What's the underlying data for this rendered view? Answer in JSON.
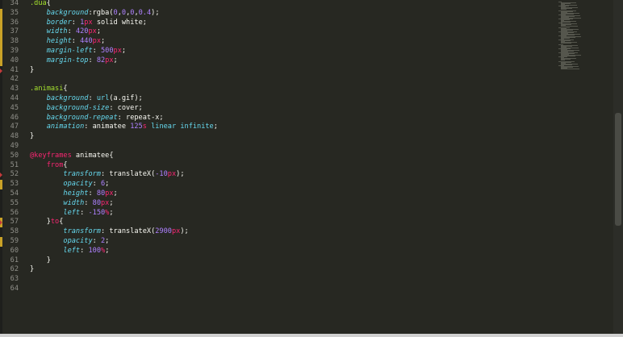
{
  "editor": {
    "lines": [
      {
        "n": "34",
        "tokens": [
          {
            "t": ".dua",
            "c": "sel"
          },
          {
            "t": "{",
            "c": "plain"
          }
        ]
      },
      {
        "n": "35",
        "tokens": [
          {
            "t": "    ",
            "c": "plain"
          },
          {
            "t": "background",
            "c": "prop"
          },
          {
            "t": ":rgba(",
            "c": "plain"
          },
          {
            "t": "0",
            "c": "num"
          },
          {
            "t": ",",
            "c": "plain"
          },
          {
            "t": "0",
            "c": "num"
          },
          {
            "t": ",",
            "c": "plain"
          },
          {
            "t": "0",
            "c": "num"
          },
          {
            "t": ",",
            "c": "plain"
          },
          {
            "t": "0.4",
            "c": "num"
          },
          {
            "t": ");",
            "c": "plain"
          }
        ]
      },
      {
        "n": "36",
        "tokens": [
          {
            "t": "    ",
            "c": "plain"
          },
          {
            "t": "border",
            "c": "prop"
          },
          {
            "t": ": ",
            "c": "plain"
          },
          {
            "t": "1",
            "c": "num"
          },
          {
            "t": "px",
            "c": "unit"
          },
          {
            "t": " solid white;",
            "c": "plain"
          }
        ]
      },
      {
        "n": "37",
        "tokens": [
          {
            "t": "    ",
            "c": "plain"
          },
          {
            "t": "width",
            "c": "prop"
          },
          {
            "t": ": ",
            "c": "plain"
          },
          {
            "t": "420",
            "c": "num"
          },
          {
            "t": "px",
            "c": "unit"
          },
          {
            "t": ";",
            "c": "plain"
          }
        ]
      },
      {
        "n": "38",
        "tokens": [
          {
            "t": "    ",
            "c": "plain"
          },
          {
            "t": "height",
            "c": "prop"
          },
          {
            "t": ": ",
            "c": "plain"
          },
          {
            "t": "440",
            "c": "num"
          },
          {
            "t": "px",
            "c": "unit"
          },
          {
            "t": ";",
            "c": "plain"
          }
        ]
      },
      {
        "n": "39",
        "tokens": [
          {
            "t": "    ",
            "c": "plain"
          },
          {
            "t": "margin-left",
            "c": "prop"
          },
          {
            "t": ": ",
            "c": "plain"
          },
          {
            "t": "500",
            "c": "num"
          },
          {
            "t": "px",
            "c": "unit"
          },
          {
            "t": ";",
            "c": "plain"
          }
        ]
      },
      {
        "n": "40",
        "tokens": [
          {
            "t": "    ",
            "c": "plain"
          },
          {
            "t": "margin-top",
            "c": "prop"
          },
          {
            "t": ": ",
            "c": "plain"
          },
          {
            "t": "82",
            "c": "num"
          },
          {
            "t": "px",
            "c": "unit"
          },
          {
            "t": ";",
            "c": "plain"
          }
        ]
      },
      {
        "n": "41",
        "tokens": [
          {
            "t": "}",
            "c": "plain"
          }
        ]
      },
      {
        "n": "42",
        "tokens": []
      },
      {
        "n": "43",
        "tokens": [
          {
            "t": ".animasi",
            "c": "sel"
          },
          {
            "t": "{",
            "c": "plain"
          }
        ]
      },
      {
        "n": "44",
        "tokens": [
          {
            "t": "    ",
            "c": "plain"
          },
          {
            "t": "background",
            "c": "prop"
          },
          {
            "t": ": ",
            "c": "plain"
          },
          {
            "t": "url",
            "c": "func"
          },
          {
            "t": "(a.gif);",
            "c": "plain"
          }
        ]
      },
      {
        "n": "45",
        "tokens": [
          {
            "t": "    ",
            "c": "plain"
          },
          {
            "t": "background-size",
            "c": "prop"
          },
          {
            "t": ": cover;",
            "c": "plain"
          }
        ]
      },
      {
        "n": "46",
        "tokens": [
          {
            "t": "    ",
            "c": "plain"
          },
          {
            "t": "background-repeat",
            "c": "prop"
          },
          {
            "t": ": repeat-x;",
            "c": "plain"
          }
        ]
      },
      {
        "n": "47",
        "tokens": [
          {
            "t": "    ",
            "c": "plain"
          },
          {
            "t": "animation",
            "c": "prop"
          },
          {
            "t": ": animatee ",
            "c": "plain"
          },
          {
            "t": "125",
            "c": "num"
          },
          {
            "t": "s",
            "c": "unit"
          },
          {
            "t": " ",
            "c": "plain"
          },
          {
            "t": "linear",
            "c": "func"
          },
          {
            "t": " ",
            "c": "plain"
          },
          {
            "t": "infinite",
            "c": "func"
          },
          {
            "t": ";",
            "c": "plain"
          }
        ]
      },
      {
        "n": "48",
        "tokens": [
          {
            "t": "}",
            "c": "plain"
          }
        ]
      },
      {
        "n": "49",
        "tokens": []
      },
      {
        "n": "50",
        "tokens": [
          {
            "t": "@keyframes",
            "c": "kw"
          },
          {
            "t": " animatee{",
            "c": "plain"
          }
        ]
      },
      {
        "n": "51",
        "tokens": [
          {
            "t": "    ",
            "c": "plain"
          },
          {
            "t": "from",
            "c": "kw"
          },
          {
            "t": "{",
            "c": "plain"
          }
        ]
      },
      {
        "n": "52",
        "tokens": [
          {
            "t": "        ",
            "c": "plain"
          },
          {
            "t": "transform",
            "c": "prop"
          },
          {
            "t": ": translateX(",
            "c": "plain"
          },
          {
            "t": "-10",
            "c": "num"
          },
          {
            "t": "px",
            "c": "unit"
          },
          {
            "t": ");",
            "c": "plain"
          }
        ]
      },
      {
        "n": "53",
        "tokens": [
          {
            "t": "        ",
            "c": "plain"
          },
          {
            "t": "opacity",
            "c": "prop"
          },
          {
            "t": ": ",
            "c": "plain"
          },
          {
            "t": "6",
            "c": "num"
          },
          {
            "t": ";",
            "c": "plain"
          }
        ]
      },
      {
        "n": "54",
        "tokens": [
          {
            "t": "        ",
            "c": "plain"
          },
          {
            "t": "height",
            "c": "prop"
          },
          {
            "t": ": ",
            "c": "plain"
          },
          {
            "t": "80",
            "c": "num"
          },
          {
            "t": "px",
            "c": "unit"
          },
          {
            "t": ";",
            "c": "plain"
          }
        ]
      },
      {
        "n": "55",
        "tokens": [
          {
            "t": "        ",
            "c": "plain"
          },
          {
            "t": "width",
            "c": "prop"
          },
          {
            "t": ": ",
            "c": "plain"
          },
          {
            "t": "80",
            "c": "num"
          },
          {
            "t": "px",
            "c": "unit"
          },
          {
            "t": ";",
            "c": "plain"
          }
        ]
      },
      {
        "n": "56",
        "tokens": [
          {
            "t": "        ",
            "c": "plain"
          },
          {
            "t": "left",
            "c": "prop"
          },
          {
            "t": ": ",
            "c": "plain"
          },
          {
            "t": "-150",
            "c": "num"
          },
          {
            "t": "%",
            "c": "unit"
          },
          {
            "t": ";",
            "c": "plain"
          }
        ]
      },
      {
        "n": "57",
        "tokens": [
          {
            "t": "    }",
            "c": "plain"
          },
          {
            "t": "to",
            "c": "kw"
          },
          {
            "t": "{",
            "c": "plain"
          }
        ]
      },
      {
        "n": "58",
        "tokens": [
          {
            "t": "        ",
            "c": "plain"
          },
          {
            "t": "transform",
            "c": "prop"
          },
          {
            "t": ": translateX(",
            "c": "plain"
          },
          {
            "t": "2900",
            "c": "num"
          },
          {
            "t": "px",
            "c": "unit"
          },
          {
            "t": ");",
            "c": "plain"
          }
        ]
      },
      {
        "n": "59",
        "tokens": [
          {
            "t": "        ",
            "c": "plain"
          },
          {
            "t": "opacity",
            "c": "prop"
          },
          {
            "t": ": ",
            "c": "plain"
          },
          {
            "t": "2",
            "c": "num"
          },
          {
            "t": ";",
            "c": "plain"
          }
        ]
      },
      {
        "n": "60",
        "tokens": [
          {
            "t": "        ",
            "c": "plain"
          },
          {
            "t": "left",
            "c": "prop"
          },
          {
            "t": ": ",
            "c": "plain"
          },
          {
            "t": "100",
            "c": "num"
          },
          {
            "t": "%",
            "c": "unit"
          },
          {
            "t": ";",
            "c": "plain"
          }
        ]
      },
      {
        "n": "61",
        "tokens": [
          {
            "t": "    }",
            "c": "plain"
          }
        ]
      },
      {
        "n": "62",
        "tokens": [
          {
            "t": "}",
            "c": "plain"
          }
        ]
      },
      {
        "n": "63",
        "tokens": []
      },
      {
        "n": "64",
        "tokens": []
      }
    ],
    "modified_lines": [
      "35",
      "36",
      "37",
      "38",
      "39",
      "40",
      "53",
      "57",
      "59"
    ],
    "error_lines": [
      "41",
      "52",
      "57"
    ]
  },
  "colors": {
    "background": "#272822",
    "selector": "#a6e22e",
    "property": "#66d9ef",
    "number": "#ae81ff",
    "unit": "#f92672",
    "keyword": "#f92672",
    "text": "#f8f8f2",
    "line_number": "#90908a"
  }
}
